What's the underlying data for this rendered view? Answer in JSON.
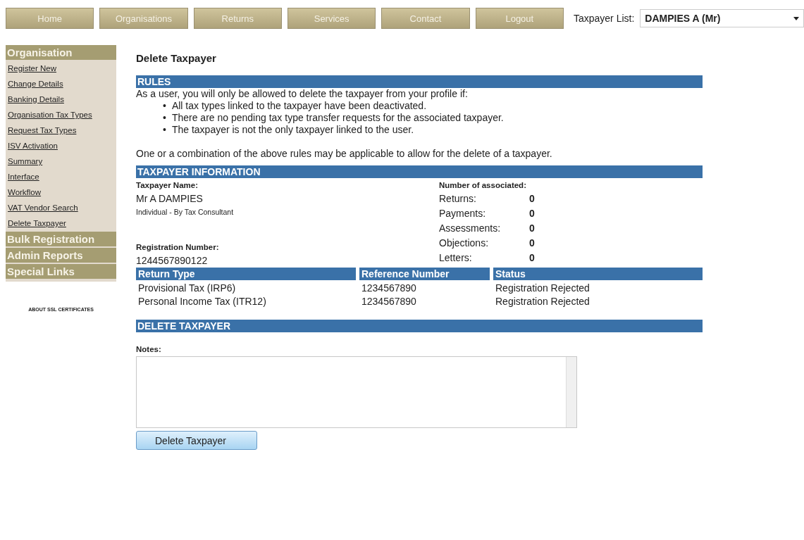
{
  "nav": {
    "tabs": [
      {
        "label": "Home",
        "selected": false
      },
      {
        "label": "Organisations",
        "selected": false
      },
      {
        "label": "Returns",
        "selected": false
      },
      {
        "label": "Services",
        "selected": false
      },
      {
        "label": "Contact",
        "selected": false
      },
      {
        "label": "Logout",
        "selected": false
      }
    ],
    "taxpayer_list": {
      "label": "Taxpayer List:",
      "value": "DAMPIES A (Mr)"
    }
  },
  "sidebar": {
    "sections": [
      {
        "title": "Organisation",
        "items": [
          "Register New",
          "Change Details",
          "Banking Details",
          "Organisation Tax Types",
          "Request Tax Types",
          "ISV Activation",
          "Summary",
          "Interface",
          "Workflow",
          "VAT Vendor Search",
          "Delete Taxpayer"
        ]
      },
      {
        "title": "Bulk Registration"
      },
      {
        "title": "Admin Reports"
      },
      {
        "title": "Special Links"
      }
    ],
    "footer": "ABOUT SSL CERTIFICATES"
  },
  "page_title": "Delete Taxpayer",
  "rules": {
    "heading": "RULES",
    "intro": "As a user, you will only be allowed to delete the taxpayer from your profile if:",
    "items": [
      {
        "bullet": "•",
        "text": "All tax types linked to the taxpayer have been deactivated."
      },
      {
        "bullet": "•",
        "text": "There are no pending tax type transfer requests for the associated taxpayer."
      },
      {
        "bullet": "•",
        "text": "The taxpayer is not the only taxpayer linked to the user."
      }
    ],
    "note": "One or a combination of the above rules may be applicable to allow for the delete of a taxpayer."
  },
  "info": {
    "heading": "TAXPAYER INFORMATION",
    "name_label": "Taxpayer Name:",
    "name": "Mr A DAMPIES",
    "type": "Individual - By Tax Consultant",
    "reg_label": "Registration Number:",
    "reg": "1244567890122",
    "counts_label": "Number of associated:",
    "counts": [
      {
        "label": "Returns:",
        "value": "0"
      },
      {
        "label": "Payments:",
        "value": "0"
      },
      {
        "label": "Assessments:",
        "value": "0"
      },
      {
        "label": "Objections:",
        "value": "0"
      },
      {
        "label": "Letters:",
        "value": "0"
      }
    ]
  },
  "table": {
    "columns": [
      "Return Type",
      "Reference Number",
      "Status"
    ],
    "rows": [
      [
        "Provisional Tax (IRP6)",
        "1234567890",
        "Registration Rejected"
      ],
      [
        "Personal Income Tax (ITR12)",
        "1234567890",
        "Registration Rejected"
      ]
    ]
  },
  "delete": {
    "heading": "DELETE TAXPAYER",
    "notes_label": "Notes:",
    "button": "Delete Taxpayer"
  }
}
